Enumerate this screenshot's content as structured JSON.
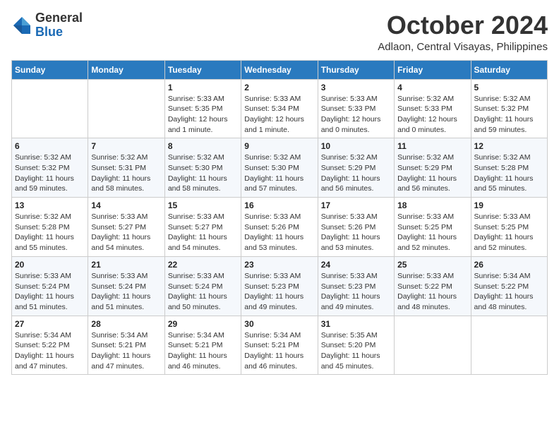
{
  "logo": {
    "general": "General",
    "blue": "Blue"
  },
  "header": {
    "month": "October 2024",
    "location": "Adlaon, Central Visayas, Philippines"
  },
  "weekdays": [
    "Sunday",
    "Monday",
    "Tuesday",
    "Wednesday",
    "Thursday",
    "Friday",
    "Saturday"
  ],
  "weeks": [
    [
      {
        "day": "",
        "info": ""
      },
      {
        "day": "",
        "info": ""
      },
      {
        "day": "1",
        "info": "Sunrise: 5:33 AM\nSunset: 5:35 PM\nDaylight: 12 hours\nand 1 minute."
      },
      {
        "day": "2",
        "info": "Sunrise: 5:33 AM\nSunset: 5:34 PM\nDaylight: 12 hours\nand 1 minute."
      },
      {
        "day": "3",
        "info": "Sunrise: 5:33 AM\nSunset: 5:33 PM\nDaylight: 12 hours\nand 0 minutes."
      },
      {
        "day": "4",
        "info": "Sunrise: 5:32 AM\nSunset: 5:33 PM\nDaylight: 12 hours\nand 0 minutes."
      },
      {
        "day": "5",
        "info": "Sunrise: 5:32 AM\nSunset: 5:32 PM\nDaylight: 11 hours\nand 59 minutes."
      }
    ],
    [
      {
        "day": "6",
        "info": "Sunrise: 5:32 AM\nSunset: 5:32 PM\nDaylight: 11 hours\nand 59 minutes."
      },
      {
        "day": "7",
        "info": "Sunrise: 5:32 AM\nSunset: 5:31 PM\nDaylight: 11 hours\nand 58 minutes."
      },
      {
        "day": "8",
        "info": "Sunrise: 5:32 AM\nSunset: 5:30 PM\nDaylight: 11 hours\nand 58 minutes."
      },
      {
        "day": "9",
        "info": "Sunrise: 5:32 AM\nSunset: 5:30 PM\nDaylight: 11 hours\nand 57 minutes."
      },
      {
        "day": "10",
        "info": "Sunrise: 5:32 AM\nSunset: 5:29 PM\nDaylight: 11 hours\nand 56 minutes."
      },
      {
        "day": "11",
        "info": "Sunrise: 5:32 AM\nSunset: 5:29 PM\nDaylight: 11 hours\nand 56 minutes."
      },
      {
        "day": "12",
        "info": "Sunrise: 5:32 AM\nSunset: 5:28 PM\nDaylight: 11 hours\nand 55 minutes."
      }
    ],
    [
      {
        "day": "13",
        "info": "Sunrise: 5:32 AM\nSunset: 5:28 PM\nDaylight: 11 hours\nand 55 minutes."
      },
      {
        "day": "14",
        "info": "Sunrise: 5:33 AM\nSunset: 5:27 PM\nDaylight: 11 hours\nand 54 minutes."
      },
      {
        "day": "15",
        "info": "Sunrise: 5:33 AM\nSunset: 5:27 PM\nDaylight: 11 hours\nand 54 minutes."
      },
      {
        "day": "16",
        "info": "Sunrise: 5:33 AM\nSunset: 5:26 PM\nDaylight: 11 hours\nand 53 minutes."
      },
      {
        "day": "17",
        "info": "Sunrise: 5:33 AM\nSunset: 5:26 PM\nDaylight: 11 hours\nand 53 minutes."
      },
      {
        "day": "18",
        "info": "Sunrise: 5:33 AM\nSunset: 5:25 PM\nDaylight: 11 hours\nand 52 minutes."
      },
      {
        "day": "19",
        "info": "Sunrise: 5:33 AM\nSunset: 5:25 PM\nDaylight: 11 hours\nand 52 minutes."
      }
    ],
    [
      {
        "day": "20",
        "info": "Sunrise: 5:33 AM\nSunset: 5:24 PM\nDaylight: 11 hours\nand 51 minutes."
      },
      {
        "day": "21",
        "info": "Sunrise: 5:33 AM\nSunset: 5:24 PM\nDaylight: 11 hours\nand 51 minutes."
      },
      {
        "day": "22",
        "info": "Sunrise: 5:33 AM\nSunset: 5:24 PM\nDaylight: 11 hours\nand 50 minutes."
      },
      {
        "day": "23",
        "info": "Sunrise: 5:33 AM\nSunset: 5:23 PM\nDaylight: 11 hours\nand 49 minutes."
      },
      {
        "day": "24",
        "info": "Sunrise: 5:33 AM\nSunset: 5:23 PM\nDaylight: 11 hours\nand 49 minutes."
      },
      {
        "day": "25",
        "info": "Sunrise: 5:33 AM\nSunset: 5:22 PM\nDaylight: 11 hours\nand 48 minutes."
      },
      {
        "day": "26",
        "info": "Sunrise: 5:34 AM\nSunset: 5:22 PM\nDaylight: 11 hours\nand 48 minutes."
      }
    ],
    [
      {
        "day": "27",
        "info": "Sunrise: 5:34 AM\nSunset: 5:22 PM\nDaylight: 11 hours\nand 47 minutes."
      },
      {
        "day": "28",
        "info": "Sunrise: 5:34 AM\nSunset: 5:21 PM\nDaylight: 11 hours\nand 47 minutes."
      },
      {
        "day": "29",
        "info": "Sunrise: 5:34 AM\nSunset: 5:21 PM\nDaylight: 11 hours\nand 46 minutes."
      },
      {
        "day": "30",
        "info": "Sunrise: 5:34 AM\nSunset: 5:21 PM\nDaylight: 11 hours\nand 46 minutes."
      },
      {
        "day": "31",
        "info": "Sunrise: 5:35 AM\nSunset: 5:20 PM\nDaylight: 11 hours\nand 45 minutes."
      },
      {
        "day": "",
        "info": ""
      },
      {
        "day": "",
        "info": ""
      }
    ]
  ]
}
